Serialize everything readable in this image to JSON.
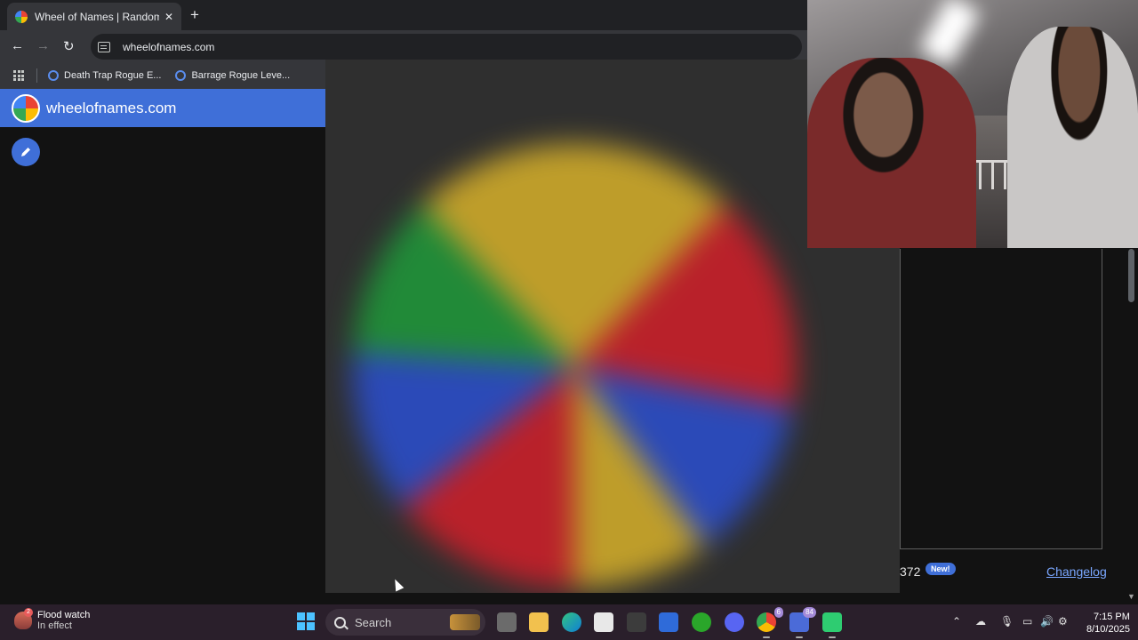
{
  "browser": {
    "tab_title": "Wheel of Names | Random name picker",
    "url": "wheelofnames.com",
    "bookmarks": [
      {
        "label": "Death Trap Rogue E..."
      },
      {
        "label": "Barrage Rogue Leve..."
      }
    ]
  },
  "app": {
    "title": "wheelofnames.com",
    "version_fragment": "372",
    "new_badge": "New!",
    "changelog_label": "Changelog"
  },
  "taskbar": {
    "weather_badge": "2",
    "weather_title": "Flood watch",
    "weather_sub": "In effect",
    "search_placeholder": "Search",
    "teams_badge": "84",
    "chrome_badge": "6",
    "time": "7:15 PM",
    "date": "8/10/2025"
  },
  "colors": {
    "accent": "#3f6fd8",
    "wheel": [
      "#d8b12a",
      "#d21f2a",
      "#2b4fd0",
      "#1f9a3a"
    ]
  },
  "icons": [
    "back-arrow-icon",
    "forward-arrow-icon",
    "reload-icon",
    "site-info-icon",
    "apps-grid-icon",
    "pencil-icon",
    "windows-start-icon",
    "search-icon",
    "chevron-up-icon",
    "microphone-icon",
    "wifi-icon",
    "speaker-icon"
  ]
}
